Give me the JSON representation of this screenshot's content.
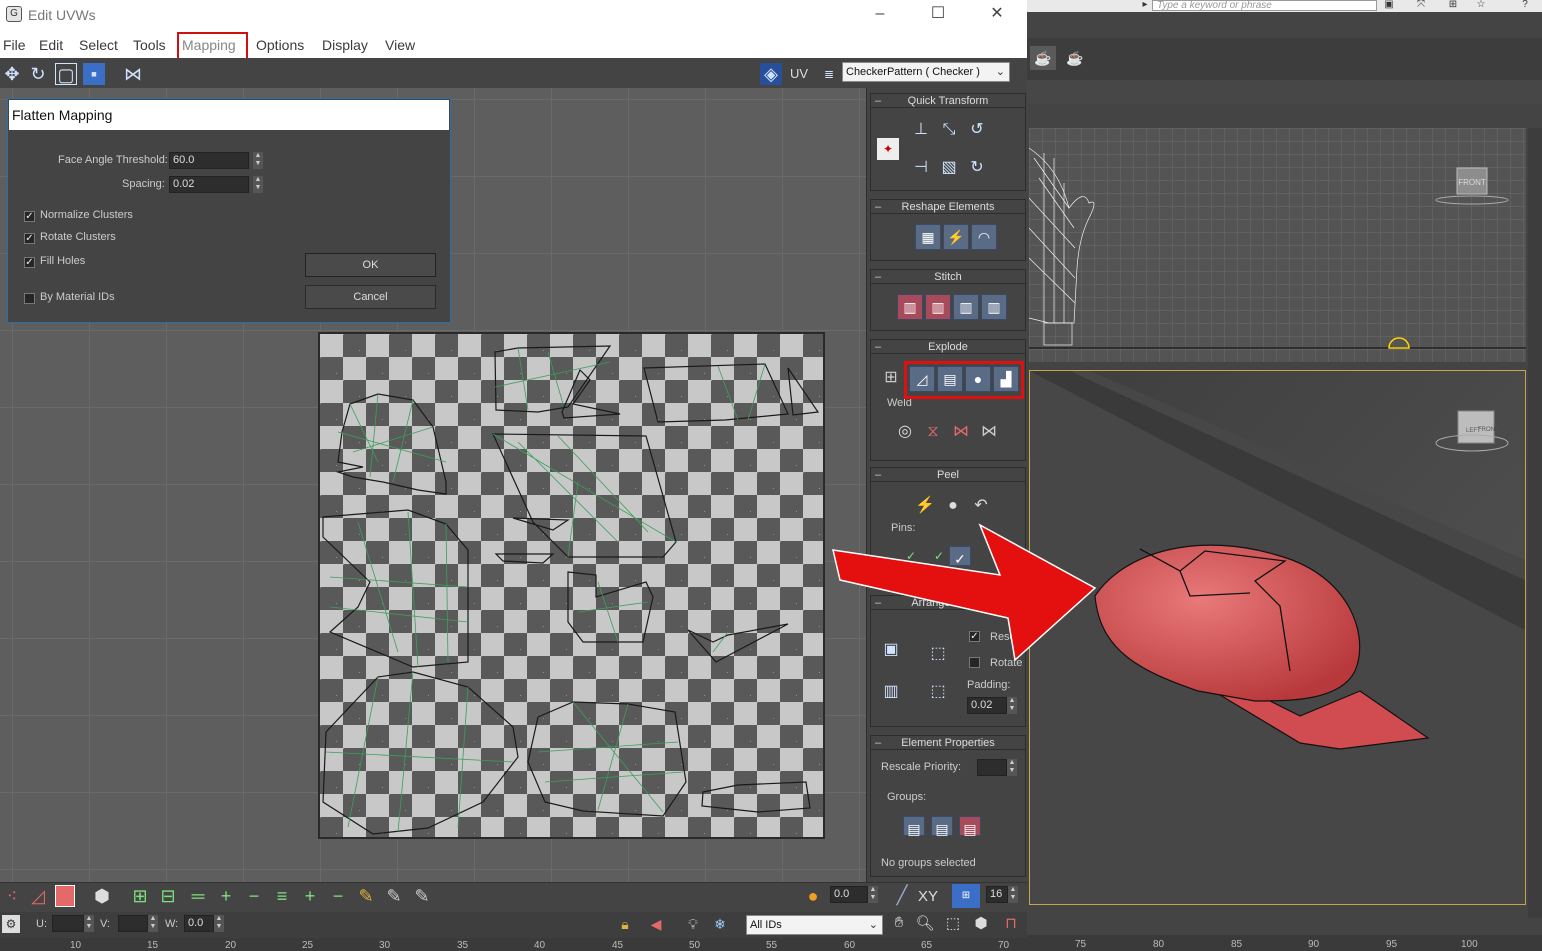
{
  "window": {
    "title": "Edit UVWs",
    "icon": "max-logo-icon"
  },
  "menu": [
    "File",
    "Edit",
    "Select",
    "Tools",
    "Mapping",
    "Options",
    "Display",
    "View"
  ],
  "toolbar": {
    "uv_label": "UV",
    "checker_value": "CheckerPattern  ( Checker )"
  },
  "dialog": {
    "title": "Flatten Mapping",
    "face_angle_label": "Face Angle Threshold:",
    "face_angle_value": "60.0",
    "spacing_label": "Spacing:",
    "spacing_value": "0.02",
    "normalize_label": "Normalize Clusters",
    "normalize_checked": true,
    "rotate_label": "Rotate Clusters",
    "rotate_checked": true,
    "fill_label": "Fill Holes",
    "fill_checked": true,
    "material_label": "By Material IDs",
    "material_checked": false,
    "ok_label": "OK",
    "cancel_label": "Cancel"
  },
  "panel": {
    "quick_transform": "Quick Transform",
    "reshape": "Reshape Elements",
    "stitch": "Stitch",
    "explode": "Explode",
    "weld": "Weld",
    "peel": "Peel",
    "pins": "Pins:",
    "arrange": "Arrange Eleme",
    "rescale": "Rescale",
    "rotate": "Rotate",
    "padding_label": "Padding:",
    "padding_value": "0.02",
    "element_props": "Element Properties",
    "rescale_priority": "Rescale Priority:",
    "groups": "Groups:",
    "no_groups": "No groups selected"
  },
  "bottom": {
    "value_a": "0.0",
    "xy_label": "XY",
    "value_b": "16",
    "u_label": "U:",
    "v_label": "V:",
    "w_label": "W:",
    "w_value": "0.0",
    "ids_value": "All IDs",
    "ruler": [
      "10",
      "15",
      "20",
      "25",
      "30",
      "35",
      "40",
      "45",
      "50",
      "55",
      "60",
      "65",
      "70"
    ]
  },
  "viewport": {
    "search_placeholder": "Type a keyword or phrase",
    "ruler": [
      "75",
      "80",
      "85",
      "90",
      "95",
      "100"
    ],
    "viewcube_top": "FRONT",
    "viewcube_persp_left": "LEFT",
    "viewcube_persp_right": "FRONT"
  },
  "colors": {
    "highlight": "#d01010",
    "cap": "#d9585a",
    "arrow": "#e41010"
  }
}
